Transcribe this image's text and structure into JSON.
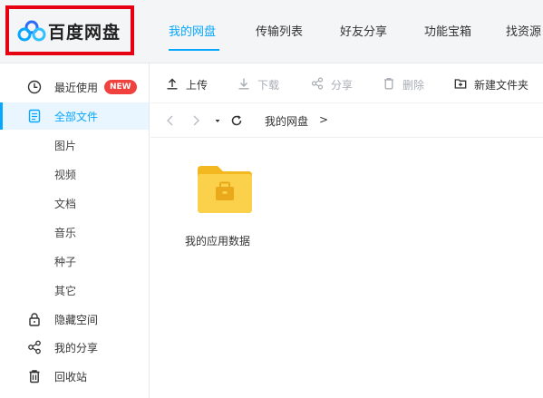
{
  "header": {
    "logo_text": "百度网盘",
    "tabs": [
      {
        "label": "我的网盘",
        "active": true
      },
      {
        "label": "传输列表",
        "active": false
      },
      {
        "label": "好友分享",
        "active": false
      },
      {
        "label": "功能宝箱",
        "active": false
      },
      {
        "label": "找资源",
        "active": false
      }
    ]
  },
  "sidebar": {
    "items": [
      {
        "label": "最近使用",
        "icon": "clock-icon",
        "badge": "NEW"
      },
      {
        "label": "全部文件",
        "icon": "document-icon",
        "active": true
      },
      {
        "label": "图片"
      },
      {
        "label": "视频"
      },
      {
        "label": "文档"
      },
      {
        "label": "音乐"
      },
      {
        "label": "种子"
      },
      {
        "label": "其它"
      },
      {
        "label": "隐藏空间",
        "icon": "lock-icon"
      },
      {
        "label": "我的分享",
        "icon": "share-icon"
      },
      {
        "label": "回收站",
        "icon": "trash-icon"
      }
    ]
  },
  "toolbar": {
    "upload": "上传",
    "download": "下载",
    "share": "分享",
    "delete": "删除",
    "new_folder": "新建文件夹"
  },
  "breadcrumb": {
    "root": "我的网盘",
    "separator": ">"
  },
  "files": [
    {
      "name": "我的应用数据",
      "type": "folder"
    }
  ],
  "colors": {
    "accent": "#06a7ff",
    "badge": "#f0413f",
    "highlight_border": "#e60012",
    "folder": "#f8c630"
  }
}
